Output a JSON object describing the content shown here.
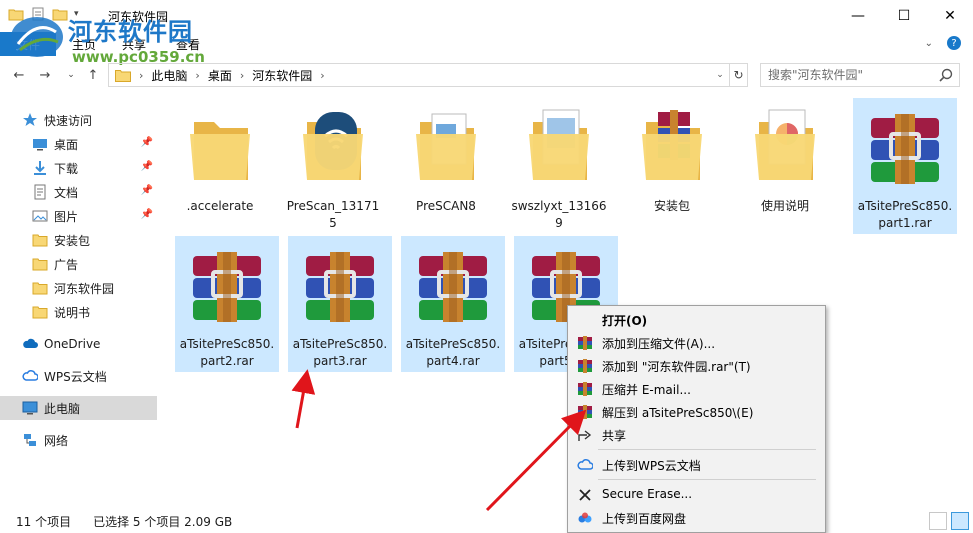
{
  "window": {
    "title": "河东软件园",
    "minimize": "—",
    "maximize": "☐",
    "close": "✕"
  },
  "watermark": {
    "title": "河东软件园",
    "url": "www.pc0359.cn"
  },
  "ribbon": {
    "tabs": [
      "文件",
      "主页",
      "共享",
      "查看"
    ]
  },
  "address": {
    "crumbs": [
      "此电脑",
      "桌面",
      "河东软件园"
    ],
    "search_placeholder": "搜索\"河东软件园\""
  },
  "sidebar": {
    "items": [
      {
        "label": "快速访问",
        "icon": "star-icon"
      },
      {
        "label": "桌面",
        "icon": "desktop-icon",
        "pinned": true
      },
      {
        "label": "下载",
        "icon": "download-icon",
        "pinned": true
      },
      {
        "label": "文档",
        "icon": "document-icon",
        "pinned": true
      },
      {
        "label": "图片",
        "icon": "picture-icon",
        "pinned": true
      },
      {
        "label": "安装包",
        "icon": "folder-icon"
      },
      {
        "label": "广告",
        "icon": "folder-icon"
      },
      {
        "label": "河东软件园",
        "icon": "folder-icon"
      },
      {
        "label": "说明书",
        "icon": "folder-icon"
      },
      {
        "label": "OneDrive",
        "icon": "cloud-icon"
      },
      {
        "label": "WPS云文档",
        "icon": "wps-cloud-icon"
      },
      {
        "label": "此电脑",
        "icon": "computer-icon",
        "selected": true
      },
      {
        "label": "网络",
        "icon": "network-icon"
      }
    ]
  },
  "files": [
    {
      "name": ".accelerate",
      "type": "folder",
      "selected": false
    },
    {
      "name": "PreScan_131715",
      "type": "folder-prescan",
      "selected": false
    },
    {
      "name": "PreSCAN8",
      "type": "folder-doc",
      "selected": false
    },
    {
      "name": "swszlyxt_131669",
      "type": "folder-doc2",
      "selected": false
    },
    {
      "name": "安装包",
      "type": "folder-rar",
      "selected": false
    },
    {
      "name": "使用说明",
      "type": "folder-pic",
      "selected": false
    },
    {
      "name": "aTsitePreSc850.part1.rar",
      "type": "rar",
      "selected": true
    },
    {
      "name": "aTsitePreSc850.part2.rar",
      "type": "rar",
      "selected": true
    },
    {
      "name": "aTsitePreSc850.part3.rar",
      "type": "rar",
      "selected": true
    },
    {
      "name": "aTsitePreSc850.part4.rar",
      "type": "rar",
      "selected": true
    },
    {
      "name": "aTsitePreSc850.part5.rar",
      "type": "rar",
      "selected": true
    }
  ],
  "context_menu": {
    "items": [
      {
        "label": "打开(O)",
        "icon": "",
        "bold": true
      },
      {
        "label": "添加到压缩文件(A)...",
        "icon": "winrar-icon"
      },
      {
        "label": "添加到 \"河东软件园.rar\"(T)",
        "icon": "winrar-icon"
      },
      {
        "label": "压缩并 E-mail...",
        "icon": "winrar-icon"
      },
      {
        "label": "解压到 aTsitePreSc850\\(E)",
        "icon": "winrar-icon"
      },
      {
        "label": "共享",
        "icon": "share-icon"
      },
      {
        "label": "上传到WPS云文档",
        "icon": "wps-cloud-icon"
      },
      {
        "label": "Secure Erase...",
        "icon": "erase-icon"
      },
      {
        "label": "上传到百度网盘",
        "icon": "baidu-cloud-icon"
      }
    ]
  },
  "status": {
    "count": "11 个项目",
    "selection": "已选择 5 个项目  2.09 GB"
  },
  "colors": {
    "accent": "#1979ca",
    "selection": "#cce8ff",
    "arrow": "#e0151b",
    "folder": "#f8d775"
  }
}
